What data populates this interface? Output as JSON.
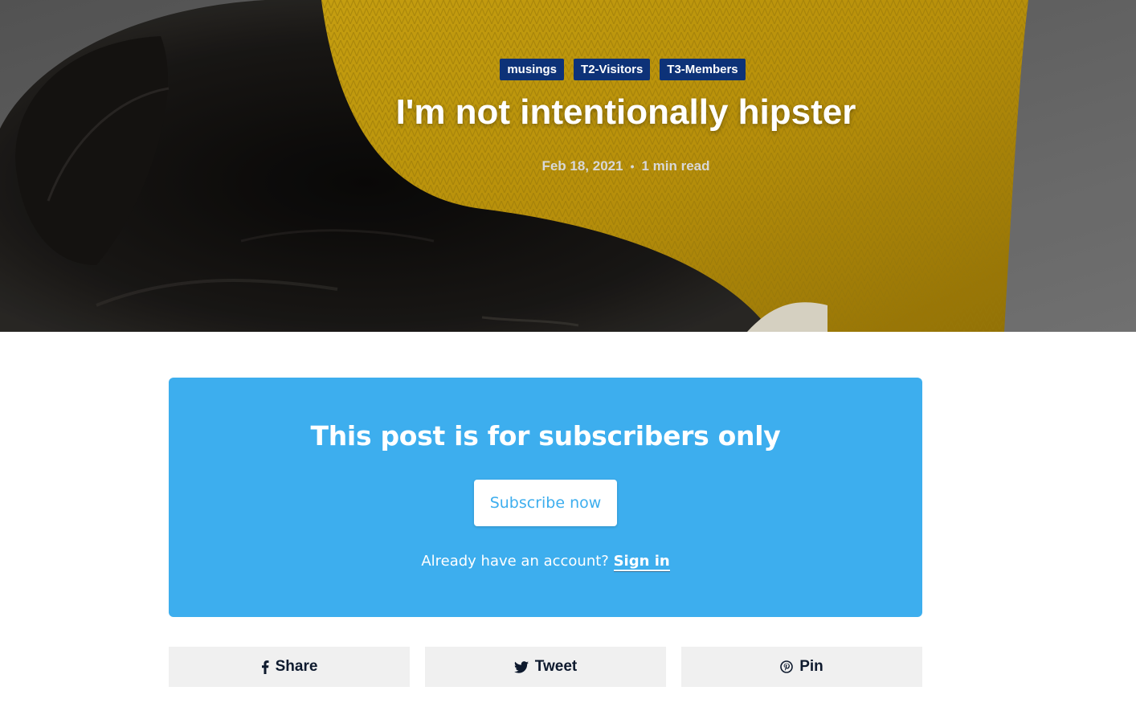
{
  "hero": {
    "tags": [
      "musings",
      "T2-Visitors",
      "T3-Members"
    ],
    "title": "I'm not intentionally hipster",
    "date": "Feb 18, 2021",
    "separator": "•",
    "read_time": "1 min read"
  },
  "subscribe": {
    "title": "This post is for subscribers only",
    "button_label": "Subscribe now",
    "account_prompt": "Already have an account?",
    "signin_label": "Sign in"
  },
  "share": {
    "facebook_label": "Share",
    "twitter_label": "Tweet",
    "pinterest_label": "Pin",
    "facebook_icon": "facebook-icon",
    "twitter_icon": "twitter-icon",
    "pinterest_icon": "pinterest-icon"
  },
  "colors": {
    "tag_bg": "#0d3278",
    "cta_bg": "#3daeee",
    "share_bg": "#f0f0f0",
    "share_text": "#0e1a2e"
  }
}
